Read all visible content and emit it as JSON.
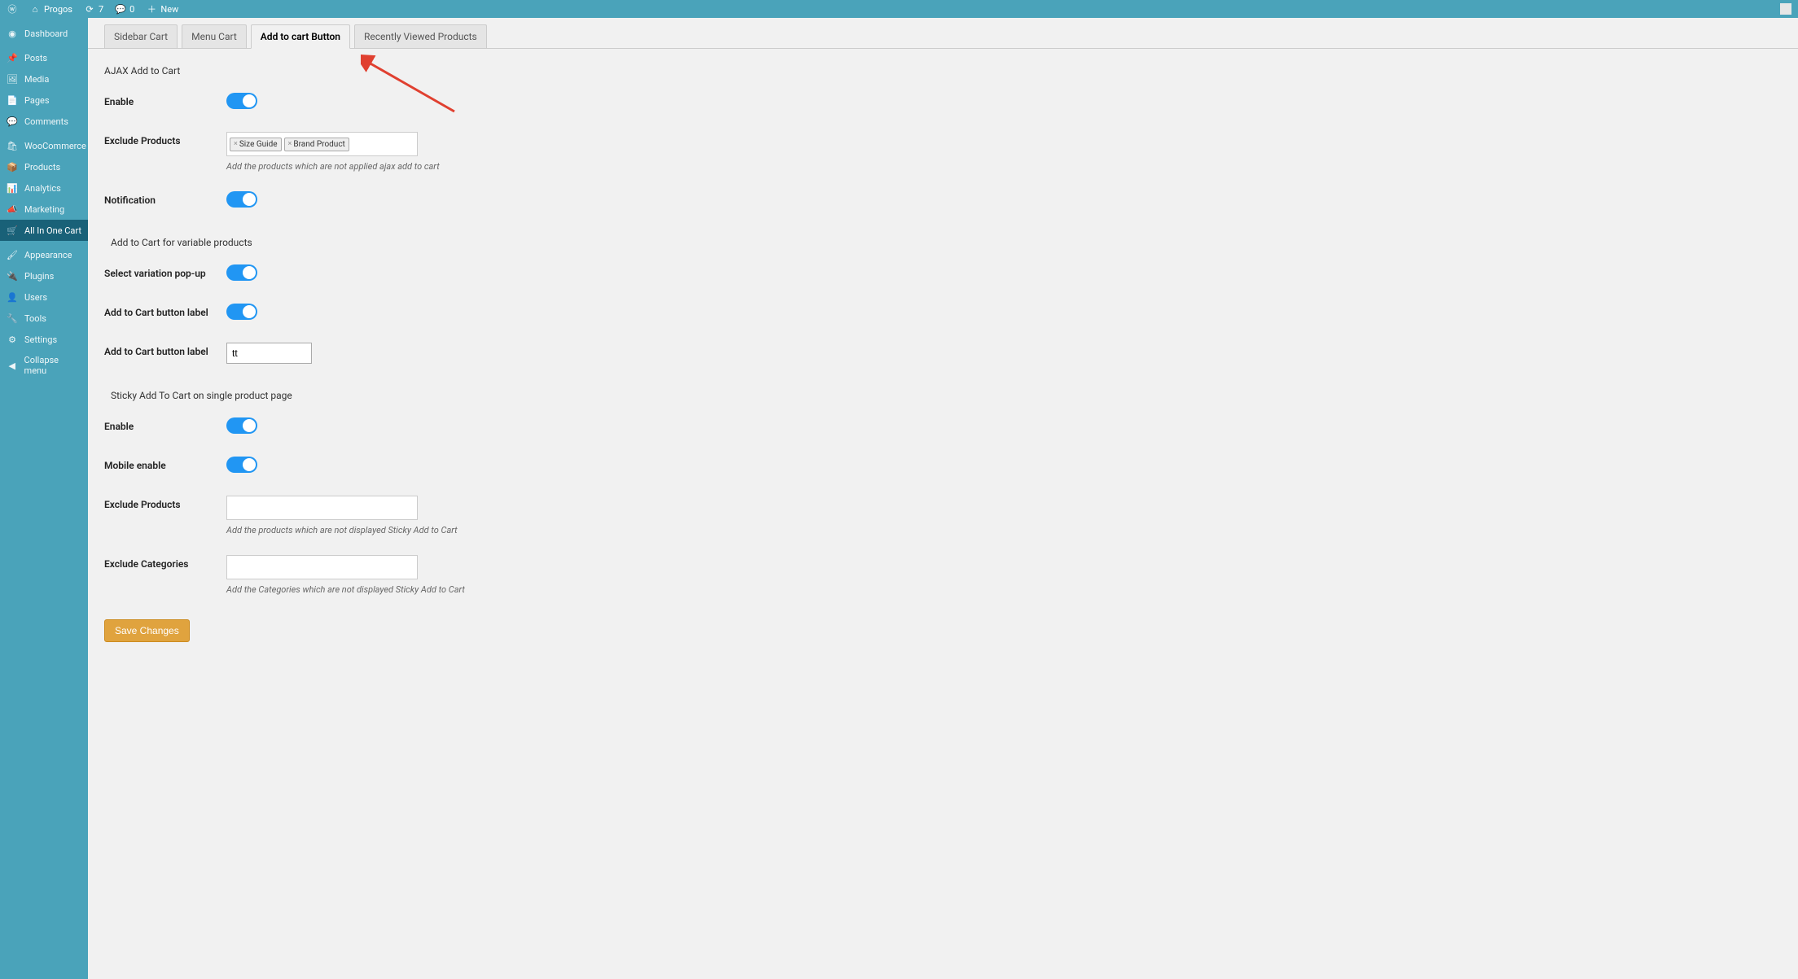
{
  "adminbar": {
    "site_name": "Progos",
    "updates_count": "7",
    "comments_count": "0",
    "new_label": "New"
  },
  "sidebar": {
    "items": [
      {
        "name": "dashboard",
        "label": "Dashboard",
        "icon": "◉"
      },
      {
        "name": "posts",
        "label": "Posts",
        "icon": "📌"
      },
      {
        "name": "media",
        "label": "Media",
        "icon": "🖼"
      },
      {
        "name": "pages",
        "label": "Pages",
        "icon": "📄"
      },
      {
        "name": "comments",
        "label": "Comments",
        "icon": "💬"
      },
      {
        "name": "woocommerce",
        "label": "WooCommerce",
        "icon": "🛍"
      },
      {
        "name": "products",
        "label": "Products",
        "icon": "📦"
      },
      {
        "name": "analytics",
        "label": "Analytics",
        "icon": "📊"
      },
      {
        "name": "marketing",
        "label": "Marketing",
        "icon": "📣"
      },
      {
        "name": "all-in-one-cart",
        "label": "All In One Cart",
        "icon": "🛒"
      },
      {
        "name": "appearance",
        "label": "Appearance",
        "icon": "🖌"
      },
      {
        "name": "plugins",
        "label": "Plugins",
        "icon": "🔌"
      },
      {
        "name": "users",
        "label": "Users",
        "icon": "👤"
      },
      {
        "name": "tools",
        "label": "Tools",
        "icon": "🔧"
      },
      {
        "name": "settings",
        "label": "Settings",
        "icon": "⚙"
      },
      {
        "name": "collapse",
        "label": "Collapse menu",
        "icon": "◀"
      }
    ],
    "active": 9
  },
  "tabs": {
    "items": [
      {
        "name": "sidebar-cart",
        "label": "Sidebar Cart"
      },
      {
        "name": "menu-cart",
        "label": "Menu Cart"
      },
      {
        "name": "add-to-cart-button",
        "label": "Add to cart Button"
      },
      {
        "name": "recently-viewed",
        "label": "Recently Viewed Products"
      }
    ],
    "active": 2
  },
  "sections": {
    "ajax": {
      "title": "AJAX Add to Cart",
      "enable_label": "Enable",
      "exclude_products_label": "Exclude Products",
      "exclude_products_tokens": [
        "Size Guide",
        "Brand Product"
      ],
      "exclude_products_desc": "Add the products which are not applied ajax add to cart",
      "notification_label": "Notification"
    },
    "variable": {
      "title": "Add to Cart for variable products",
      "variation_popup_label": "Select variation pop-up",
      "button_label_toggle_label": "Add to Cart button label",
      "button_label_input_label": "Add to Cart button label",
      "button_label_value": "tt"
    },
    "sticky": {
      "title": "Sticky Add To Cart on single product page",
      "enable_label": "Enable",
      "mobile_enable_label": "Mobile enable",
      "exclude_products_label": "Exclude Products",
      "exclude_products_desc": "Add the products which are not displayed Sticky Add to Cart",
      "exclude_categories_label": "Exclude Categories",
      "exclude_categories_desc": "Add the Categories which are not displayed Sticky Add to Cart"
    }
  },
  "save_button": "Save Changes"
}
